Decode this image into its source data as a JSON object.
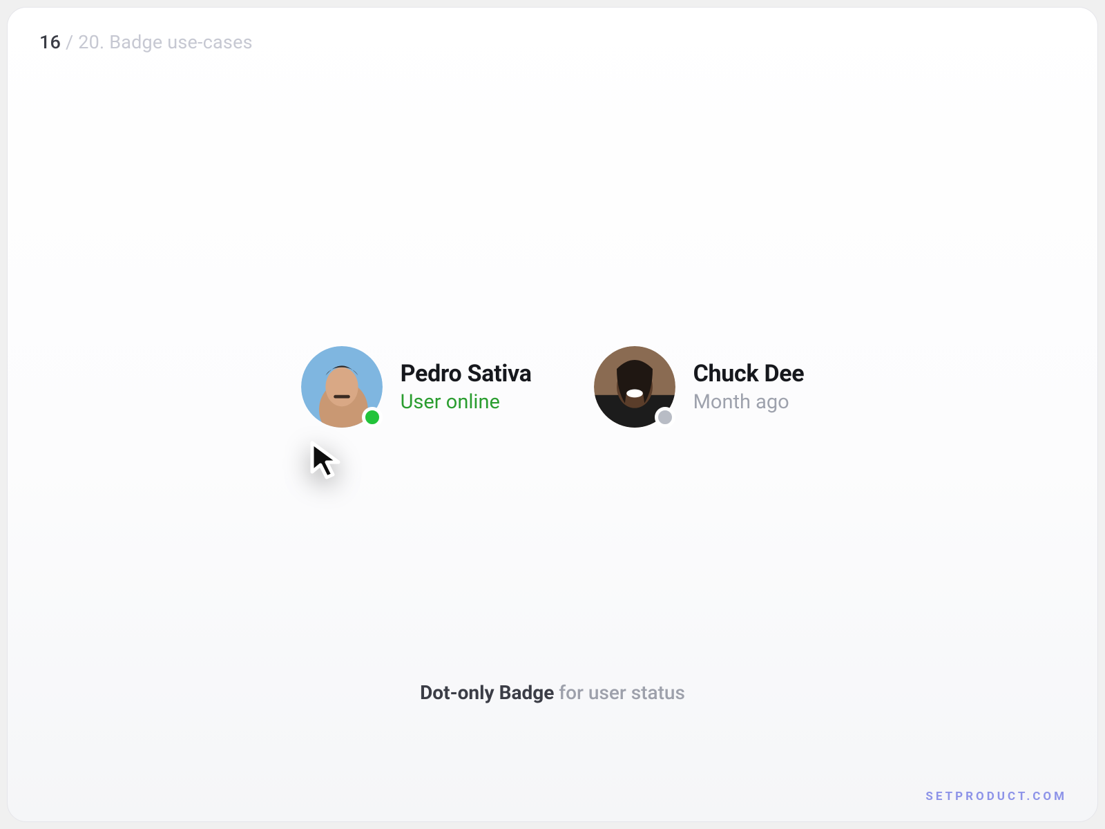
{
  "breadcrumb": {
    "current": "16",
    "sep": " / ",
    "total_and_title": "20. Badge use-cases"
  },
  "users": [
    {
      "name": "Pedro Sativa",
      "status": "User online",
      "online": true,
      "avatar_bg": "#7fb6e0",
      "badge_color": "#22c33a"
    },
    {
      "name": "Chuck Dee",
      "status": "Month ago",
      "online": false,
      "avatar_bg": "#6b4a34",
      "badge_color": "#b8bcc5"
    }
  ],
  "caption": {
    "strong": "Dot-only Badge",
    "rest": " for user status"
  },
  "watermark": "SETPRODUCT.COM",
  "colors": {
    "online_text": "#2a9d2f",
    "offline_text": "#9ea2ad"
  }
}
